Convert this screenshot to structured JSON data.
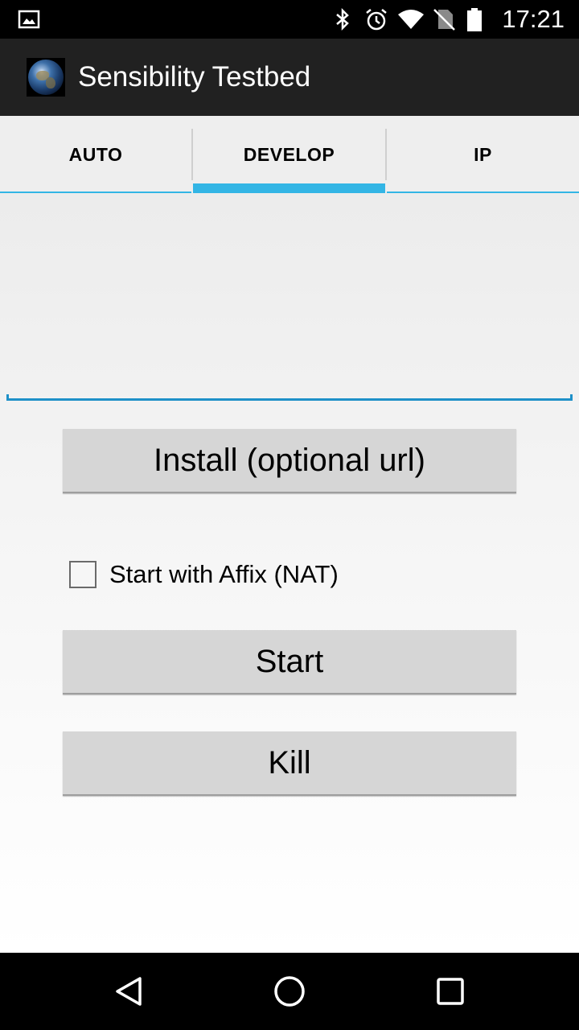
{
  "status_bar": {
    "time": "17:21",
    "icons": [
      "image-icon",
      "bluetooth-icon",
      "alarm-icon",
      "wifi-icon",
      "no-sim-icon",
      "battery-icon"
    ]
  },
  "app": {
    "title": "Sensibility Testbed",
    "icon": "earth-globe-icon"
  },
  "tabs": [
    {
      "label": "AUTO",
      "selected": false
    },
    {
      "label": "DEVELOP",
      "selected": true
    },
    {
      "label": "IP",
      "selected": false
    }
  ],
  "develop": {
    "url_input_value": "",
    "install_button": "Install (optional url)",
    "affix_checkbox_label": "Start with Affix (NAT)",
    "affix_checked": false,
    "start_button": "Start",
    "kill_button": "Kill"
  },
  "nav_bar": {
    "icons": [
      "back-icon",
      "home-icon",
      "recents-icon"
    ]
  },
  "colors": {
    "accent": "#33b5e5",
    "action_bar": "#212121",
    "button": "#d6d6d6"
  }
}
